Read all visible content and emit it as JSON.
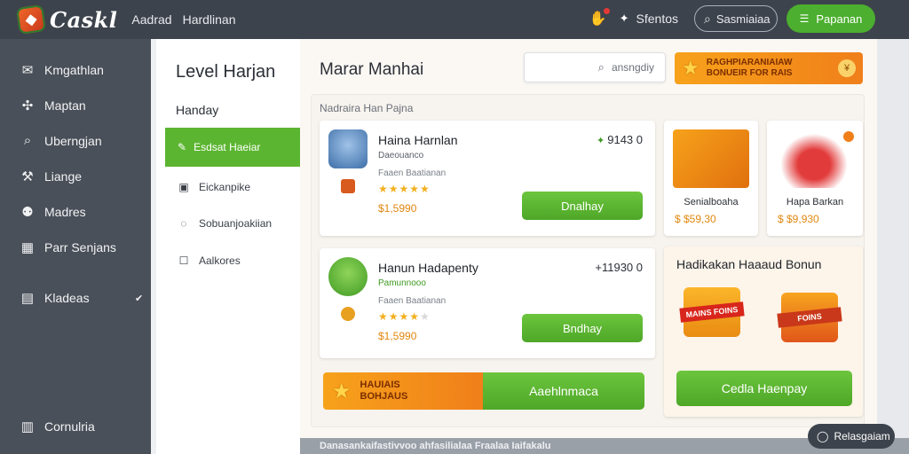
{
  "app": {
    "logo_text": "Caskl",
    "nav": [
      "Aadrad",
      "Hardlinan"
    ]
  },
  "topbar": {
    "status_label": "Sfentos",
    "search_label": "Sasmiaiaa",
    "primary_button": "Papanan"
  },
  "sidebar": {
    "items": [
      {
        "label": "Kmgathlan",
        "icon": "message-icon"
      },
      {
        "label": "Maptan",
        "icon": "puzzle-icon"
      },
      {
        "label": "Uberngjan",
        "icon": "search-icon"
      },
      {
        "label": "Liange",
        "icon": "wrench-icon"
      },
      {
        "label": "Madres",
        "icon": "users-icon"
      },
      {
        "label": "Parr Senjans",
        "icon": "chart-icon"
      },
      {
        "label": "Kladeas",
        "icon": "grid-icon"
      }
    ],
    "footer_item": "Cornulria"
  },
  "subpanel": {
    "title": "Level Harjan",
    "section_label": "Handay",
    "active_item": "Esdsat Haeiar",
    "items": [
      "Eickanpike",
      "Sobuanjoakiian",
      "Aalkores"
    ]
  },
  "main": {
    "title": "Marar Manhai",
    "search_placeholder": "ansngdiy",
    "promo_top": {
      "line1": "RAGHPIARANIAIAW",
      "line2": "BONUEIR FOR RAIS"
    },
    "section_label": "Nadraira Han Pajna",
    "quests": [
      {
        "name": "Haina Harnlan",
        "badge": "Daeouanco",
        "meta": "Faaen Baatianan",
        "rating": 4.5,
        "price": "$1,5990",
        "reward": "9143 0",
        "button": "Dnalhay"
      },
      {
        "name": "Hanun Hadapenty",
        "badge": "Pamunnooo",
        "meta": "Faaen Baatianan",
        "rating": 4,
        "price": "$1,5990",
        "reward": "+11930 0",
        "button": "Bndhay"
      }
    ],
    "shop": [
      {
        "name": "Senialboaha",
        "price": "$ $59,30"
      },
      {
        "name": "Hapa Barkan",
        "price": "$ $9,930"
      }
    ],
    "bonus": {
      "title": "Hadikakan Haaaud Bonun",
      "gift_label_1": "MAINS FOINS",
      "gift_label_2": "FOINS"
    },
    "promo_bottom": {
      "line1": "HAUIAIS",
      "line2": "BOHJAUS"
    },
    "bottom_buttons": [
      "Aaehlnmaca",
      "Cedla Haenpay"
    ]
  },
  "bottom_strip_text": "Danasankaifastivvoo ahfasilialaa Fraalaa Iaifakalu",
  "help_button": "Relasgaiam",
  "colors": {
    "accent_green": "#5cb531",
    "accent_orange": "#f7a21b",
    "topbar": "#3d434c",
    "sidebar": "#4a5059"
  }
}
